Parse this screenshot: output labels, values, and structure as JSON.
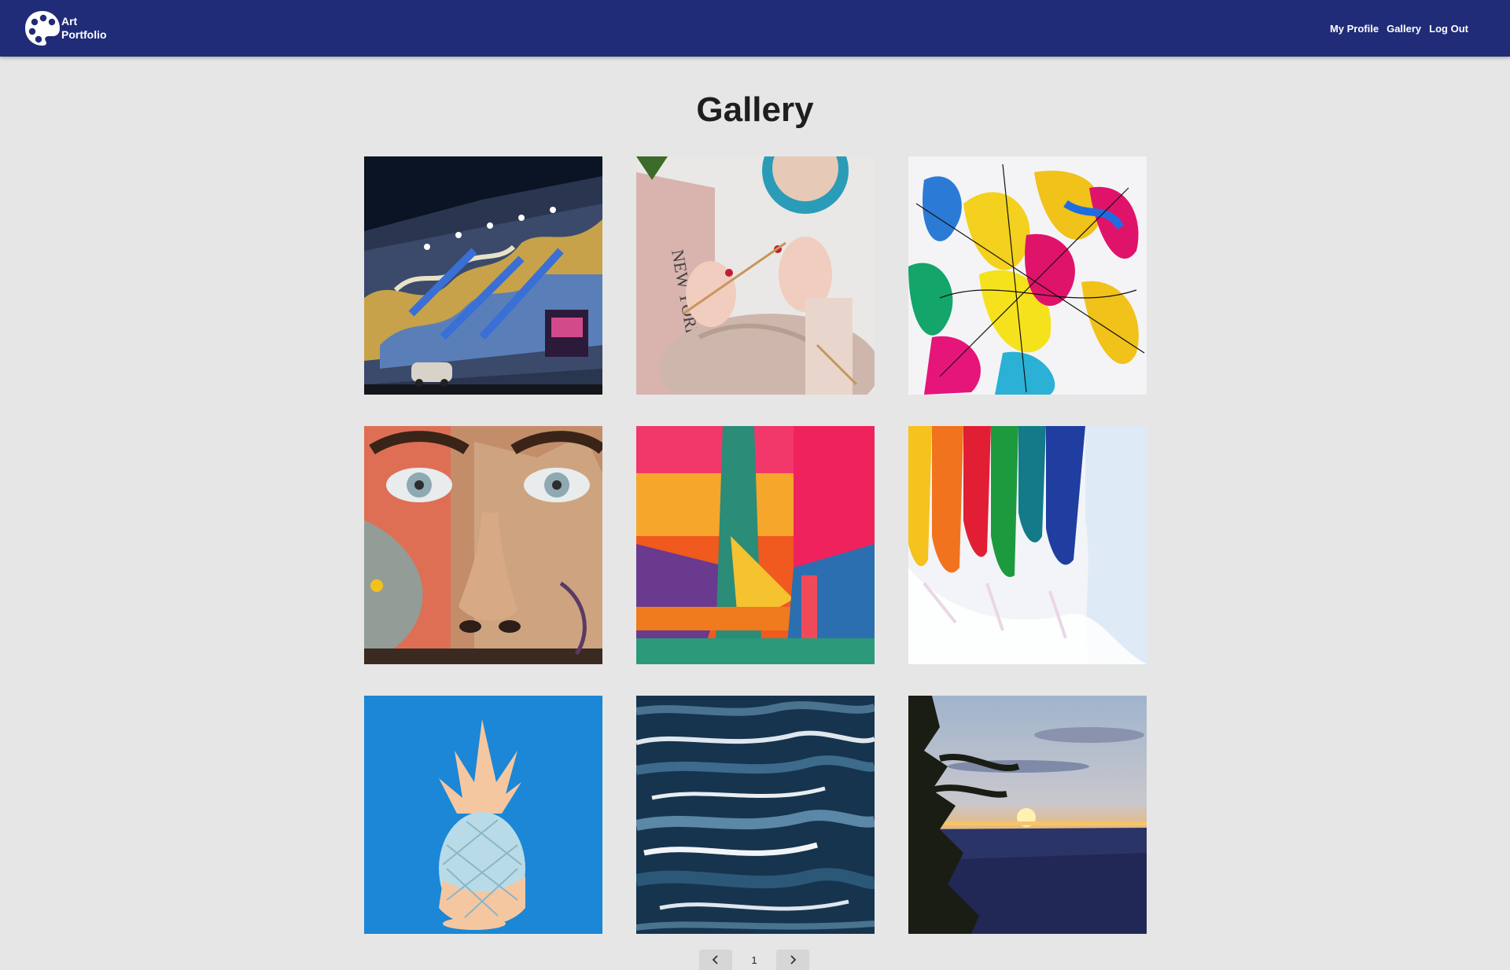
{
  "navbar": {
    "brand_line1": "Art",
    "brand_line2": "Portfolio",
    "logo_icon": "palette-icon",
    "links": [
      "My Profile",
      "Gallery",
      "Log Out"
    ],
    "background": "#202c77"
  },
  "page": {
    "title": "Gallery"
  },
  "gallery": {
    "items": [
      {
        "subject": "street-mural-night"
      },
      {
        "subject": "knitting-coffee"
      },
      {
        "subject": "abstract-paint-splash"
      },
      {
        "subject": "face-mural"
      },
      {
        "subject": "abstract-orange-pink"
      },
      {
        "subject": "rainbow-paint-drip"
      },
      {
        "subject": "pineapple-blue"
      },
      {
        "subject": "ocean-waves-painting"
      },
      {
        "subject": "canyon-sunset"
      }
    ]
  },
  "pagination": {
    "current_page": "1",
    "prev_icon": "chevron-left-icon",
    "next_icon": "chevron-right-icon"
  }
}
